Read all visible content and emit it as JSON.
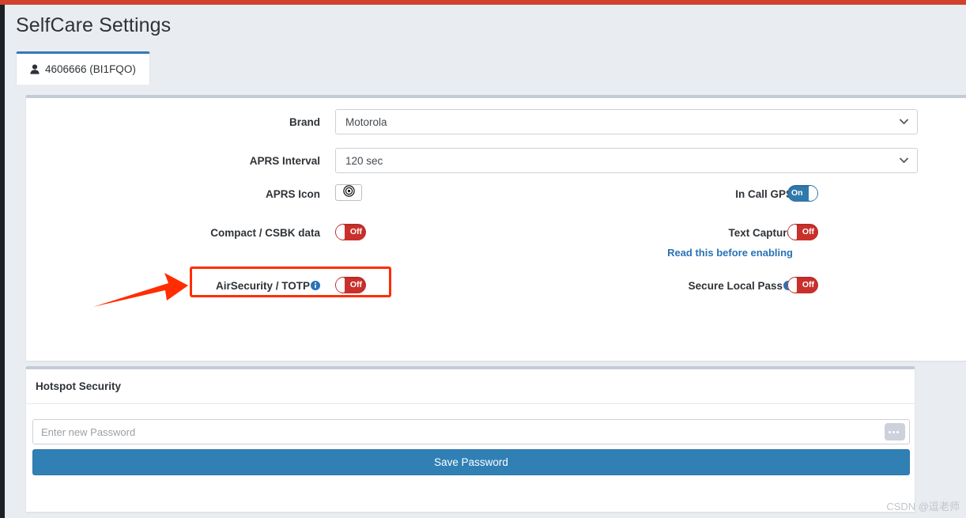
{
  "window": {
    "title": "SelfCare Settings",
    "accent_red": "#d0412e",
    "accent_blue": "#337ab7",
    "toggle_on_color": "#3079ab",
    "toggle_off_color": "#c9302c",
    "highlight_color": "#ff2d00"
  },
  "tabs": [
    {
      "label": "4606666 (BI1FQO)",
      "icon": "person-icon",
      "active": true
    }
  ],
  "settings_card": {
    "rows": {
      "brand": {
        "label": "Brand",
        "value": "Motorola",
        "icon": "chevron-down-icon"
      },
      "aprs_interval": {
        "label": "APRS Interval",
        "value": "120 sec",
        "icon": "chevron-down-icon"
      },
      "aprs_icon": {
        "label": "APRS Icon",
        "icon": "aprs-target-icon"
      },
      "compact_csbk": {
        "label": "Compact / CSBK data",
        "state": "Off"
      },
      "air_security": {
        "label": "AirSecurity / TOTP",
        "state": "Off",
        "icon": "info-icon",
        "highlighted": true
      },
      "in_call_gps": {
        "label": "In Call GPS",
        "state": "On"
      },
      "text_capture": {
        "label": "Text Capture",
        "state": "Off",
        "help_link": "Read this before enabling"
      },
      "secure_local_pass": {
        "label": "Secure Local Pass",
        "state": "Off",
        "icon": "info-icon"
      }
    }
  },
  "hotspot_card": {
    "header": "Hotspot Security",
    "password": {
      "placeholder": "Enter new Password",
      "value": "",
      "reveal_icon": "password-dots-icon"
    },
    "save_button": "Save Password"
  },
  "watermark": "CSDN @逗老师"
}
